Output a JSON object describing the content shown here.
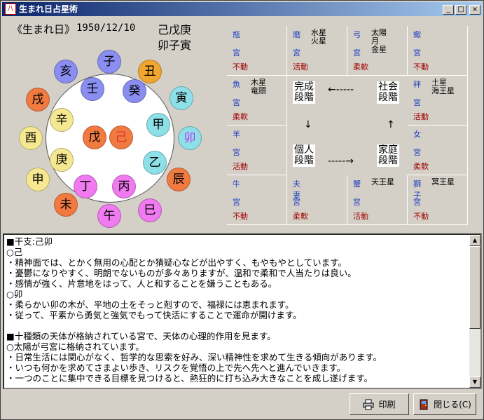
{
  "window": {
    "title": "生まれ日占星術",
    "icon_label": "八",
    "controls": {
      "minimize": "_",
      "maximize": "□",
      "close": "×"
    }
  },
  "header": {
    "label": "《生まれ日》",
    "date": "1950/12/10",
    "kanshi_top": "己戊庚",
    "kanshi_bottom": "卯子寅"
  },
  "zodiac_ring": [
    {
      "char": "子",
      "color": "#8a8ef0"
    },
    {
      "char": "丑",
      "color": "#f0a630"
    },
    {
      "char": "寅",
      "color": "#8ee0e8"
    },
    {
      "char": "卯",
      "color": "#8ee0e8",
      "text_color": "#c030f0"
    },
    {
      "char": "辰",
      "color": "#f07a40"
    },
    {
      "char": "巳",
      "color": "#f07af0"
    },
    {
      "char": "午",
      "color": "#f07af0"
    },
    {
      "char": "未",
      "color": "#f07a40"
    },
    {
      "char": "申",
      "color": "#f5e890"
    },
    {
      "char": "酉",
      "color": "#f5e890"
    },
    {
      "char": "戌",
      "color": "#f07a40"
    },
    {
      "char": "亥",
      "color": "#8a8ef0"
    }
  ],
  "stems_ring": [
    {
      "char": "壬",
      "color": "#8a8ef0"
    },
    {
      "char": "癸",
      "color": "#8a8ef0"
    },
    {
      "char": "甲",
      "color": "#8ee0e8"
    },
    {
      "char": "乙",
      "color": "#8ee0e8"
    },
    {
      "char": "丙",
      "color": "#f07af0"
    },
    {
      "char": "丁",
      "color": "#f07af0"
    },
    {
      "char": "庚",
      "color": "#f5e890"
    },
    {
      "char": "辛",
      "color": "#f5e890"
    },
    {
      "char": "戊",
      "color": "#f07a40"
    },
    {
      "char": "己",
      "color": "#f07a40",
      "text_color": "#e03030"
    }
  ],
  "grid": {
    "cells": [
      {
        "sign": "瓶",
        "miya": "宮",
        "quality": "不動",
        "planets": ""
      },
      {
        "sign": "磨",
        "miya": "宮",
        "quality": "活動",
        "planets": "水星\n火星"
      },
      {
        "sign": "弓",
        "miya": "宮",
        "quality": "柔軟",
        "planets": "太陽\n月\n金星"
      },
      {
        "sign": "蠍",
        "miya": "宮",
        "quality": "不動",
        "planets": ""
      },
      {
        "sign": "魚",
        "miya": "宮",
        "quality": "柔軟",
        "planets": "木星\n竜頭"
      },
      {
        "sign": "秤",
        "miya": "宮",
        "quality": "活動",
        "planets": "土星\n海王星"
      },
      {
        "sign": "羊",
        "miya": "宮",
        "quality": "活動",
        "planets": ""
      },
      {
        "sign": "女",
        "miya": "宮",
        "quality": "柔軟",
        "planets": ""
      },
      {
        "sign": "牛",
        "miya": "宮",
        "quality": "不動",
        "planets": ""
      },
      {
        "sign": "夫\n妻",
        "miya": "宮",
        "quality": "柔軟",
        "planets": ""
      },
      {
        "sign": "蟹",
        "miya": "宮",
        "quality": "活動",
        "planets": "天王星"
      },
      {
        "sign": "獅\n子",
        "miya": "宮",
        "quality": "不動",
        "planets": "冥王星"
      }
    ],
    "stages": {
      "complete": "完成\n段階",
      "social": "社会\n段階",
      "individual": "個人\n段階",
      "family": "家庭\n段階"
    },
    "arrows": {
      "top": "←-----",
      "bottom": "-----→",
      "left": "↓",
      "right": "↑"
    }
  },
  "text_lines": [
    "■干支:己卯",
    "○己",
    "・精神面では、とかく無用の心配とか猜疑心などが出やすく、もやもやとしています。",
    "・憂鬱になりやすく、明朗でないものが多々ありますが、温和で柔和で人当たりは良い。",
    "・感情が強く、片意地をはって、人と和することを嫌うこともある。",
    "○卯",
    "・柔らかい卯の木が、平地の土をそっと剋すので、福禄には恵まれます。",
    "・従って、平素から勇気と強気でもって快活にすることで運命が開けます。",
    "",
    "■十種類の天体が格納されている宮で、天体の心理的作用を見ます。",
    "○太陽が弓宮に格納されています。",
    "・日常生活には関心がなく、哲学的な思索を好み、深い精神性を求めて生きる傾向があります。",
    "・いつも何かを求めてさまよい歩き、リスクを覚悟の上で先へ先へと進んでいきます。",
    "・一つのことに集中できる目標を見つけると、熱狂的に打ち込み大きなことを成し遂げます。"
  ],
  "buttons": {
    "print": "印刷",
    "close": "閉じる(C)"
  },
  "scrollbar": {
    "up": "▲",
    "down": "▼"
  }
}
